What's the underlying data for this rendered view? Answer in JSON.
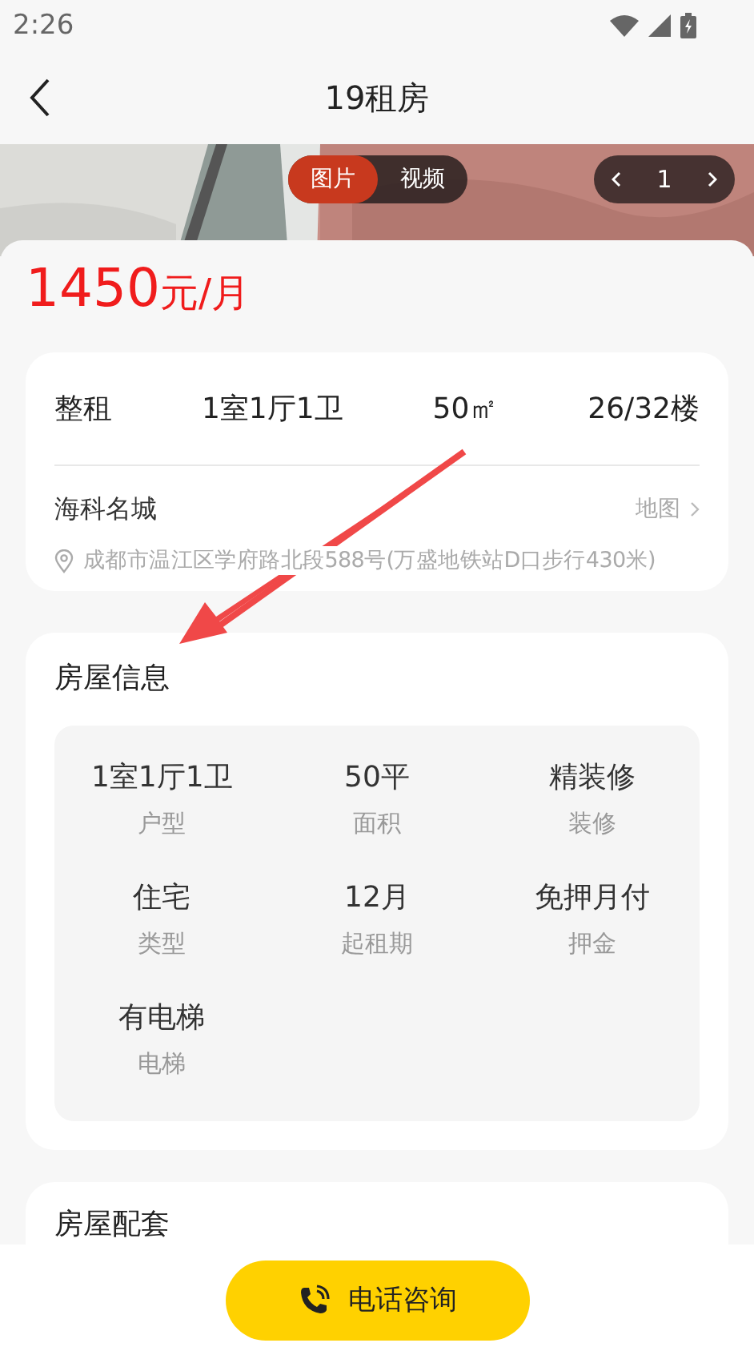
{
  "status_bar": {
    "time": "2:26"
  },
  "nav": {
    "title": "19租房"
  },
  "media": {
    "kind": "picture",
    "tabs": [
      {
        "label": "图片",
        "selected": true
      },
      {
        "label": "视频",
        "selected": false
      }
    ],
    "page": "1"
  },
  "price": {
    "amount": "1450",
    "unit": "元/月"
  },
  "summary": {
    "facts": [
      "整租",
      "1室1厅1卫",
      "50㎡",
      "26/32楼"
    ],
    "community": "海科名城",
    "map_link": "地图",
    "address": "成都市温江区学府路北段588号(万盛地铁站D口步行430米)"
  },
  "house_info": {
    "title": "房屋信息",
    "items": [
      {
        "value": "1室1厅1卫",
        "label": "户型"
      },
      {
        "value": "50平",
        "label": "面积"
      },
      {
        "value": "精装修",
        "label": "装修"
      },
      {
        "value": "住宅",
        "label": "类型"
      },
      {
        "value": "12月",
        "label": "起租期"
      },
      {
        "value": "免押月付",
        "label": "押金"
      },
      {
        "value": "有电梯",
        "label": "电梯"
      }
    ]
  },
  "next_section": {
    "title": "房屋配套"
  },
  "call_button": {
    "label": "电话咨询"
  }
}
